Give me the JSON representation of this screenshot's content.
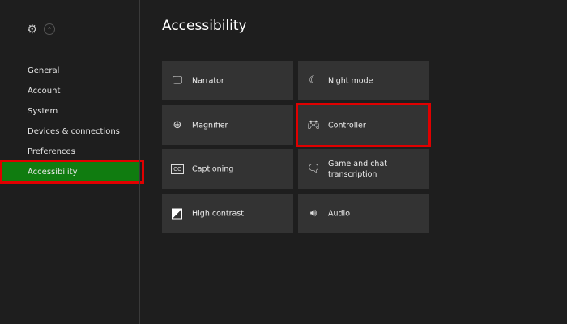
{
  "sidebar": {
    "items": [
      {
        "label": "General"
      },
      {
        "label": "Account"
      },
      {
        "label": "System"
      },
      {
        "label": "Devices & connections"
      },
      {
        "label": "Preferences"
      },
      {
        "label": "Accessibility",
        "active": true
      }
    ]
  },
  "header": {
    "title": "Accessibility"
  },
  "tiles": [
    {
      "label": "Narrator",
      "icon": "narrator-icon"
    },
    {
      "label": "Night mode",
      "icon": "night-mode-icon"
    },
    {
      "label": "Magnifier",
      "icon": "magnifier-icon"
    },
    {
      "label": "Controller",
      "icon": "controller-icon"
    },
    {
      "label": "Captioning",
      "icon": "captioning-icon"
    },
    {
      "label": "Game and chat transcription",
      "icon": "chat-transcription-icon"
    },
    {
      "label": "High contrast",
      "icon": "high-contrast-icon"
    },
    {
      "label": "Audio",
      "icon": "audio-icon"
    }
  ],
  "colors": {
    "accent": "#107c10",
    "highlight": "#e00000",
    "tile": "#333333",
    "background": "#1e1e1e"
  }
}
